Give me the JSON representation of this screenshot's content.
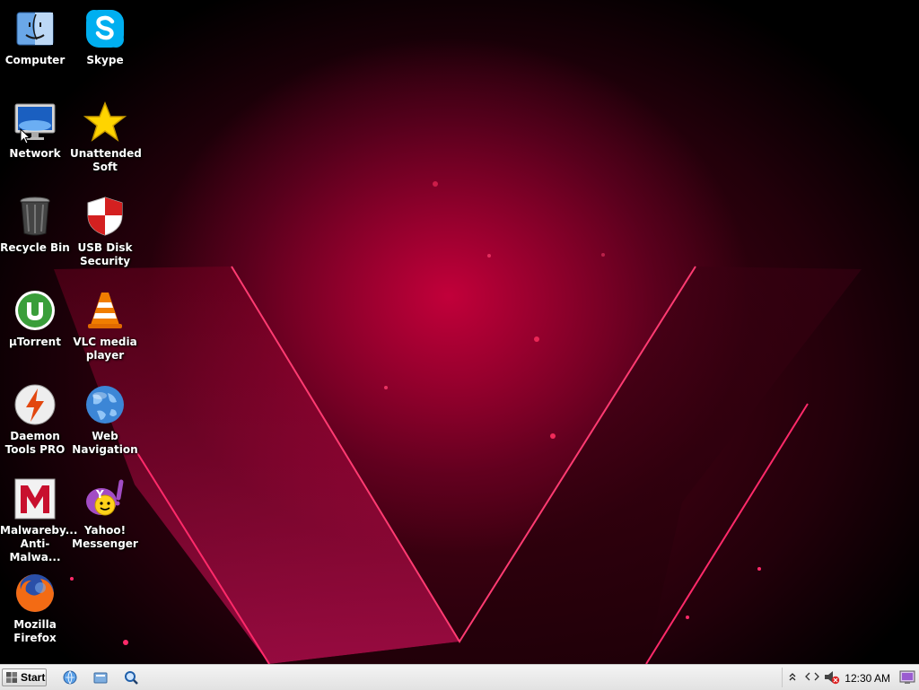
{
  "desktop": {
    "icons": [
      {
        "label": "Computer",
        "icon": "finder-icon"
      },
      {
        "label": "Skype",
        "icon": "skype-icon"
      },
      {
        "label": "Network",
        "icon": "monitor-icon"
      },
      {
        "label": "Unattended\nSoft",
        "icon": "star-icon"
      },
      {
        "label": "Recycle Bin",
        "icon": "trash-icon"
      },
      {
        "label": "USB Disk\nSecurity",
        "icon": "shield-icon"
      },
      {
        "label": "µTorrent",
        "icon": "utorrent-icon"
      },
      {
        "label": "VLC media\nplayer",
        "icon": "vlc-cone-icon"
      },
      {
        "label": "Daemon\nTools PRO",
        "icon": "lightning-disc-icon"
      },
      {
        "label": "Web\nNavigation",
        "icon": "globe-icon"
      },
      {
        "label": "Malwareby...\nAnti-Malwa...",
        "icon": "malwarebytes-icon"
      },
      {
        "label": "Yahoo!\nMessenger",
        "icon": "yahoo-messenger-icon"
      },
      {
        "label": "Mozilla\nFirefox",
        "icon": "firefox-icon"
      }
    ]
  },
  "taskbar": {
    "start_label": "Start",
    "quick_launch": [
      "browser-icon",
      "file-manager-icon",
      "search-icon"
    ],
    "tray_icons": [
      "expand-arrows-icon",
      "network-arrows-icon",
      "volume-muted-icon",
      "display-icon"
    ],
    "clock": "12:30 AM"
  },
  "colors": {
    "accent": "#e0104a",
    "taskbar_bg": "#ececec"
  }
}
